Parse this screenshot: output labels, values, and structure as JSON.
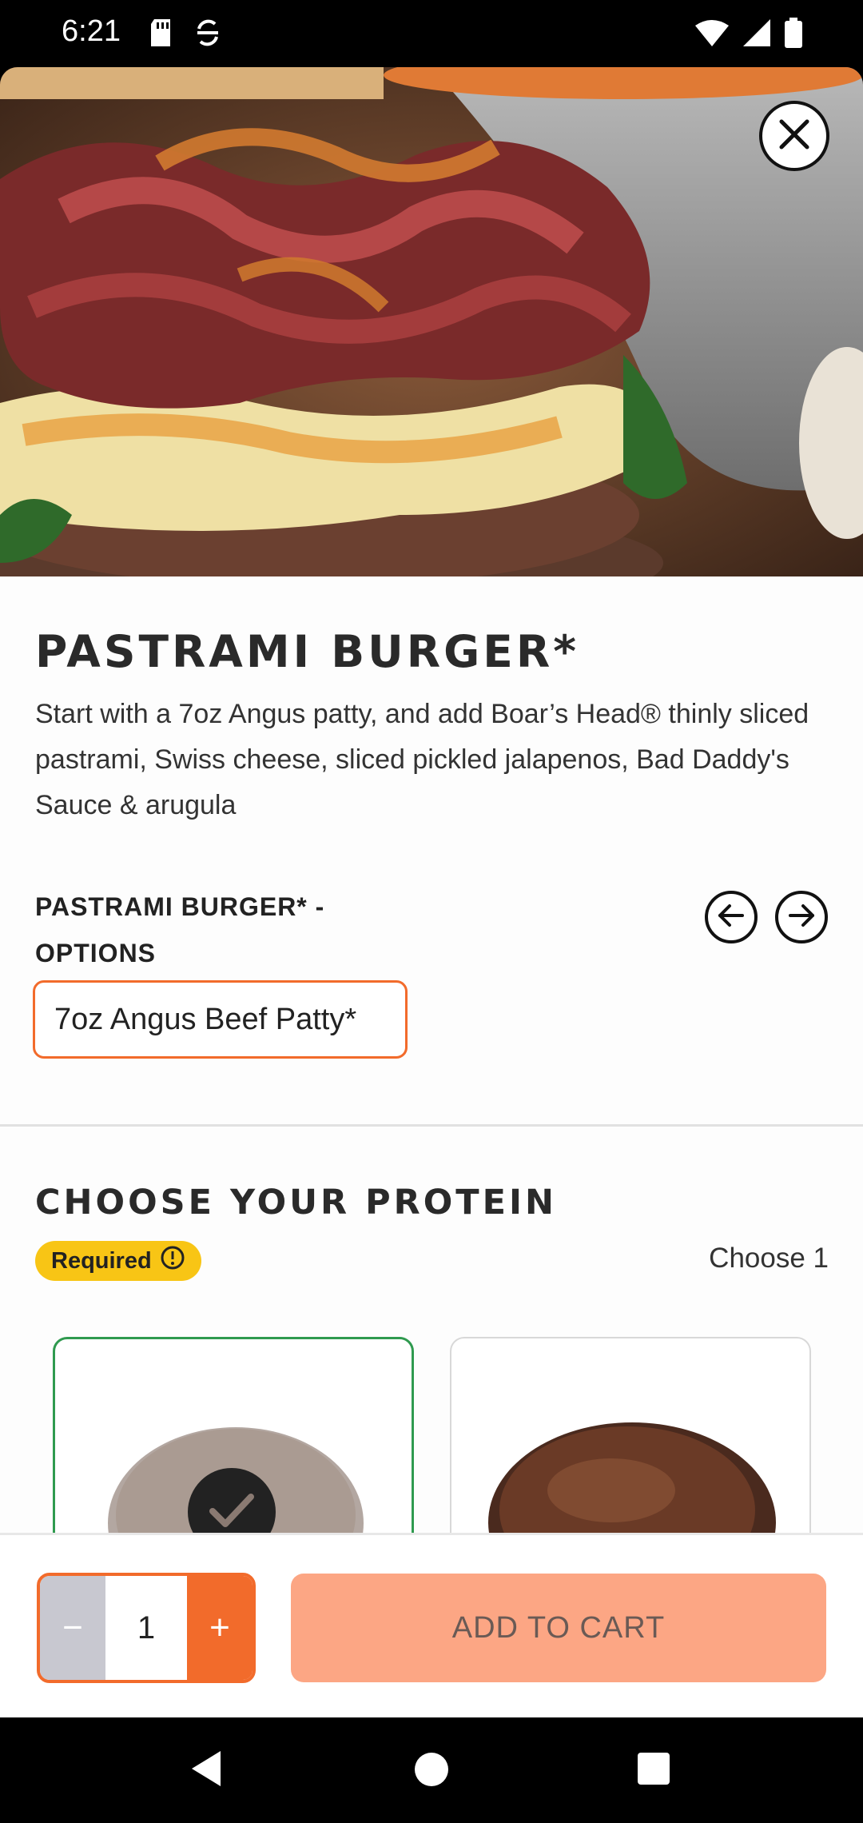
{
  "status_bar": {
    "time": "6:21"
  },
  "product": {
    "title": "PASTRAMI BURGER*",
    "description": "Start with a 7oz Angus patty, and add Boar’s Head® thinly sliced pastrami, Swiss cheese, sliced pickled jalapenos, Bad Daddy's Sauce & arugula",
    "options_heading": "PASTRAMI BURGER* - OPTIONS",
    "selected_option": "7oz Angus Beef Patty*"
  },
  "protein_section": {
    "title": "CHOOSE YOUR PROTEIN",
    "required_label": "Required",
    "choose_count": "Choose 1"
  },
  "cart": {
    "quantity": "1",
    "minus_label": "−",
    "plus_label": "+",
    "add_to_cart_label": "ADD TO CART"
  },
  "colors": {
    "accent": "#f26b2b",
    "required_badge": "#f8c515",
    "selected_border": "#2f9a4f",
    "add_to_cart_bg": "#fca684"
  },
  "icons": [
    "close-icon",
    "arrow-left-icon",
    "arrow-right-icon",
    "info-icon",
    "check-icon",
    "sd-card-icon",
    "sync-icon",
    "wifi-icon",
    "signal-icon",
    "battery-icon",
    "nav-back-icon",
    "nav-home-icon",
    "nav-recent-icon"
  ]
}
